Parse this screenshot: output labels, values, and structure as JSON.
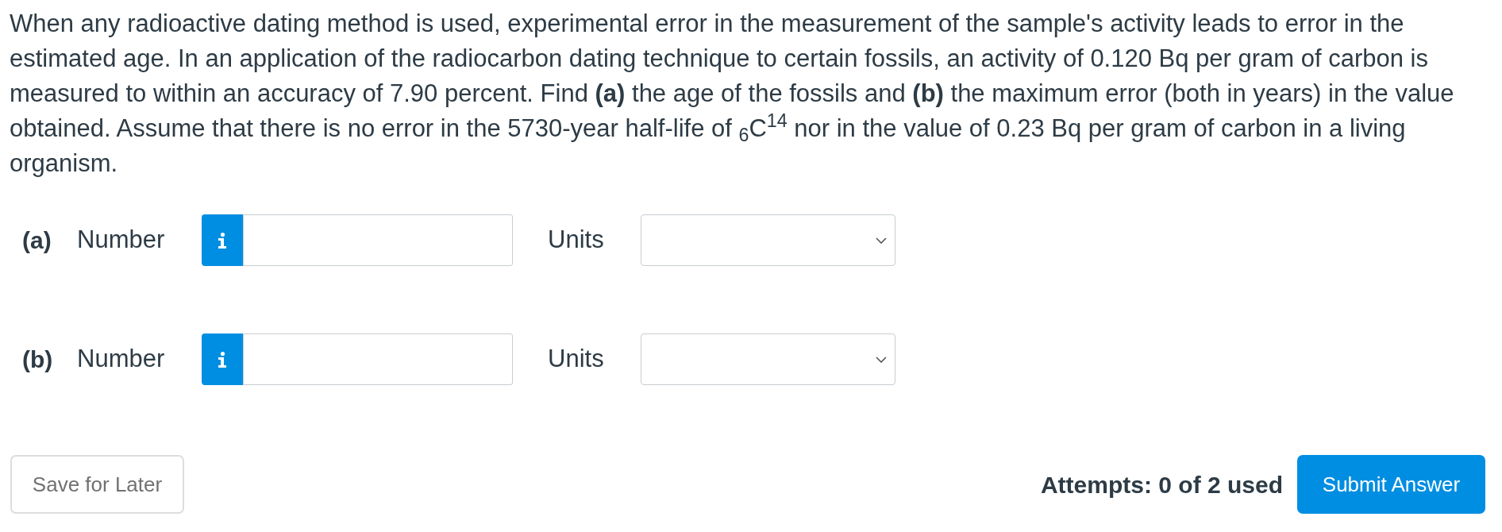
{
  "question": {
    "text": "When any radioactive dating method is used, experimental error in the measurement of the sample's activity leads to error in the estimated age. In an application of the radiocarbon dating technique to certain fossils, an activity of 0.120 Bq per gram of carbon is measured to within an accuracy of 7.90 percent. Find **(a)** the age of the fossils and **(b)** the maximum error (both in years) in the value obtained. Assume that there is no error in the 5730-year half-life of $_{6}$C$^{14}$ nor in the value of 0.23 Bq per gram of carbon in a living organism."
  },
  "parts": [
    {
      "label": "(a)",
      "number_label": "Number",
      "units_label": "Units"
    },
    {
      "label": "(b)",
      "number_label": "Number",
      "units_label": "Units"
    }
  ],
  "footer": {
    "save_button": "Save for Later",
    "attempts": "Attempts: 0 of 2 used",
    "submit_button": "Submit Answer"
  }
}
